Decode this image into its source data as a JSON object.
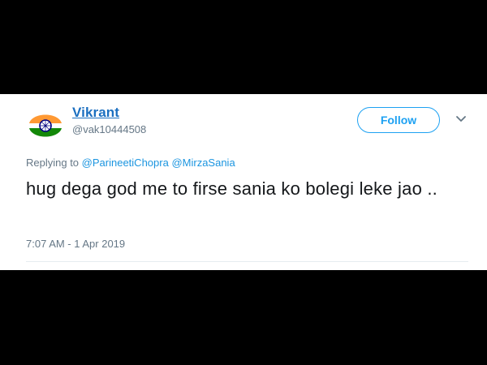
{
  "user": {
    "display_name": "Vikrant",
    "handle": "@vak10444508",
    "avatar_icon": "india-flag-icon"
  },
  "actions": {
    "follow_label": "Follow",
    "more_icon": "chevron-down-icon"
  },
  "reply": {
    "prefix": "Replying to",
    "mentions": [
      "@ParineetiChopra",
      "@MirzaSania"
    ]
  },
  "tweet": {
    "text": "hug dega god me to firse sania ko bolegi leke jao ..",
    "timestamp": "7:07 AM - 1 Apr 2019"
  },
  "colors": {
    "accent": "#1da1f2",
    "name": "#1b6fc0",
    "secondary_text": "#657786",
    "primary_text": "#14171a",
    "flag_saffron": "#ff9933",
    "flag_green": "#138808",
    "flag_chakra": "#000080"
  }
}
